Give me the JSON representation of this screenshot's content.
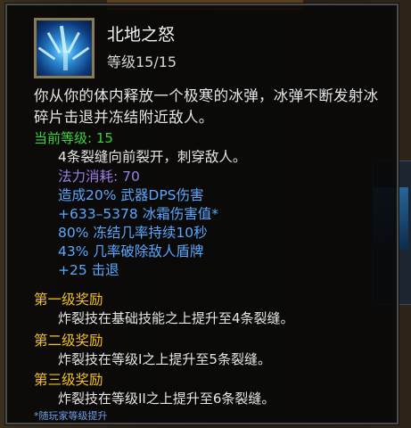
{
  "skill": {
    "name": "北地之怒",
    "level": "等级15/15",
    "description": "你从你的体内释放一个极寒的冰弹，冰弹不断发射冰碎片击退并冻结附近敌人。",
    "icon": "ice-shards-icon"
  },
  "current": {
    "heading": "当前等级: 15",
    "lines": [
      "4条裂缝向前裂开，刺穿敌人。",
      "法力消耗: 70",
      "造成20% 武器DPS伤害",
      "+633–5378 冰霜伤害值*",
      "80% 冻结几率持续10秒",
      "43% 几率破除敌人盾牌",
      "+25 击退"
    ]
  },
  "tiers": [
    {
      "label": "第一级奖励",
      "desc": "炸裂技在基础技能之上提升至4条裂缝。"
    },
    {
      "label": "第二级奖励",
      "desc": "炸裂技在等级I之上提升至5条裂缝。"
    },
    {
      "label": "第三级奖励",
      "desc": "炸裂技在等级II之上提升至6条裂缝。"
    }
  ],
  "footnote": "*随玩家等级提升",
  "colors": {
    "green": "#3ad23a",
    "purple": "#9b7ee8",
    "blue": "#5aa7ff",
    "gold": "#f2c21a"
  }
}
